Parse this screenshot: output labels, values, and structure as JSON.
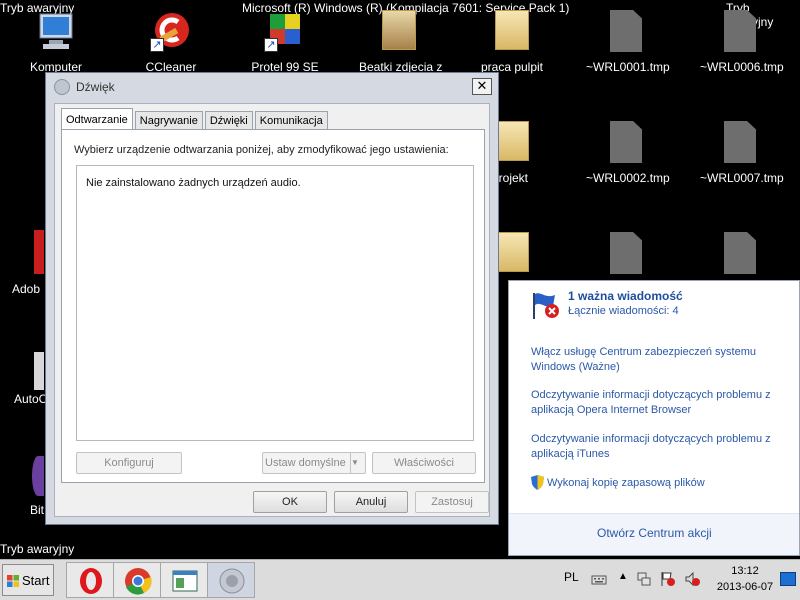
{
  "desktop": {
    "safe_mode_label": "Tryb awaryjny",
    "title_text": "Microsoft (R) Windows (R) (Kompilacja 7601: Service Pack 1)",
    "icons": [
      {
        "label": "Komputer"
      },
      {
        "label": "CCleaner"
      },
      {
        "label": "Protel 99 SE"
      },
      {
        "label": "Beatki zdjecia z"
      },
      {
        "label": "praca pulpit"
      },
      {
        "label": "~WRL0001.tmp"
      },
      {
        "label": "~WRL0006.tmp"
      },
      {
        "label": "rojekt"
      },
      {
        "label": "~WRL0002.tmp"
      },
      {
        "label": "~WRL0007.tmp"
      },
      {
        "label": "Adob"
      },
      {
        "label": "AutoC"
      },
      {
        "label": "Bit"
      }
    ]
  },
  "dialog": {
    "title": "Dźwięk",
    "close_label": "✕",
    "tabs": [
      {
        "label": "Odtwarzanie"
      },
      {
        "label": "Nagrywanie"
      },
      {
        "label": "Dźwięki"
      },
      {
        "label": "Komunikacja"
      }
    ],
    "instruction": "Wybierz urządzenie odtwarzania poniżej, aby zmodyfikować jego ustawienia:",
    "empty_message": "Nie zainstalowano żadnych urządzeń audio.",
    "buttons": {
      "configure": "Konfiguruj",
      "set_default": "Ustaw domyślne",
      "properties": "Właściwości",
      "ok": "OK",
      "cancel": "Anuluj",
      "apply": "Zastosuj"
    }
  },
  "notification": {
    "title": "1 ważna wiadomość",
    "count": "Łącznie wiadomości: 4",
    "messages": [
      {
        "text": "Włącz usługę Centrum zabezpieczeń systemu Windows (Ważne)"
      },
      {
        "text": "Odczytywanie informacji dotyczących problemu z aplikacją Opera Internet Browser"
      },
      {
        "text": "Odczytywanie informacji dotyczących problemu z aplikacją iTunes"
      },
      {
        "text": "Wykonaj kopię zapasową plików"
      }
    ],
    "footer_link": "Otwórz Centrum akcji"
  },
  "taskbar": {
    "start_label": "Start",
    "language": "PL",
    "time": "13:12",
    "date": "2013-06-07",
    "tray_expand": "▲"
  },
  "colors": {
    "link": "#2a59a8",
    "title_blue": "#1e4d9c",
    "error_red": "#d42020"
  }
}
